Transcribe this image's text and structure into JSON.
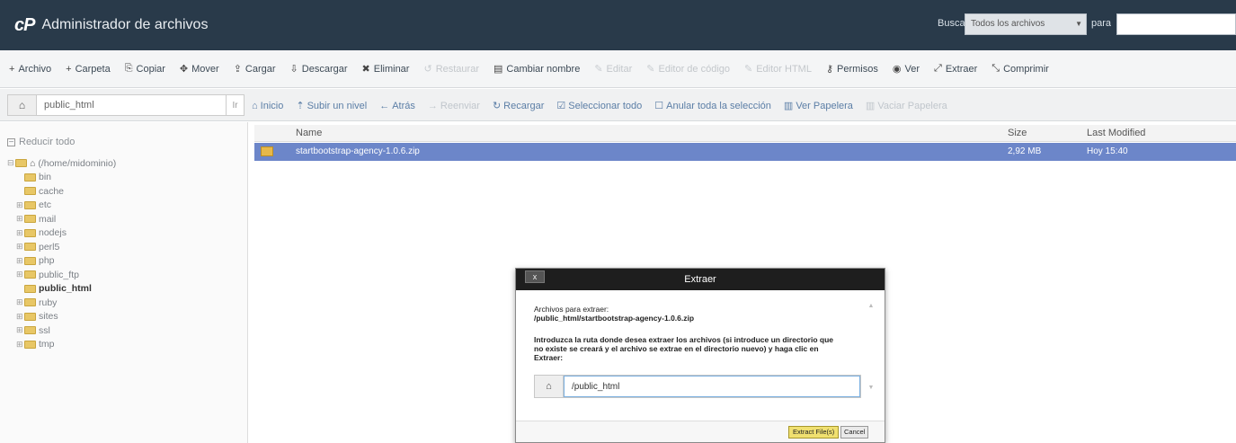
{
  "header": {
    "logo": "cP",
    "title": "Administrador de archivos",
    "search_label": "Buscar",
    "search_scope": "Todos los archivos",
    "search_for_label": "para",
    "search_value": ""
  },
  "toolbar": [
    {
      "icon": "+",
      "label": "Archivo",
      "disabled": false
    },
    {
      "icon": "+",
      "label": "Carpeta",
      "disabled": false
    },
    {
      "icon": "⎘",
      "label": "Copiar",
      "disabled": false
    },
    {
      "icon": "✥",
      "label": "Mover",
      "disabled": false
    },
    {
      "icon": "⇪",
      "label": "Cargar",
      "disabled": false
    },
    {
      "icon": "⇩",
      "label": "Descargar",
      "disabled": false
    },
    {
      "icon": "✖",
      "label": "Eliminar",
      "disabled": false
    },
    {
      "icon": "↺",
      "label": "Restaurar",
      "disabled": true
    },
    {
      "icon": "▤",
      "label": "Cambiar nombre",
      "disabled": false
    },
    {
      "icon": "✎",
      "label": "Editar",
      "disabled": true
    },
    {
      "icon": "✎",
      "label": "Editor de código",
      "disabled": true
    },
    {
      "icon": "✎",
      "label": "Editor HTML",
      "disabled": true
    },
    {
      "icon": "⚷",
      "label": "Permisos",
      "disabled": false
    },
    {
      "icon": "◉",
      "label": "Ver",
      "disabled": false
    },
    {
      "icon": "⤢",
      "label": "Extraer",
      "disabled": false
    },
    {
      "icon": "⤡",
      "label": "Comprimir",
      "disabled": false
    }
  ],
  "nav": {
    "path": "public_html",
    "go": "Ir",
    "buttons": [
      {
        "icon": "⌂",
        "label": "Inicio",
        "disabled": false
      },
      {
        "icon": "⇡",
        "label": "Subir un nivel",
        "disabled": false
      },
      {
        "icon": "←",
        "label": "Atrás",
        "disabled": false
      },
      {
        "icon": "→",
        "label": "Reenviar",
        "disabled": true
      },
      {
        "icon": "↻",
        "label": "Recargar",
        "disabled": false
      },
      {
        "icon": "☑",
        "label": "Seleccionar todo",
        "disabled": false
      },
      {
        "icon": "☐",
        "label": "Anular toda la selección",
        "disabled": false
      },
      {
        "icon": "▥",
        "label": "Ver Papelera",
        "disabled": false
      },
      {
        "icon": "▥",
        "label": "Vaciar Papelera",
        "disabled": true
      }
    ]
  },
  "tree": {
    "collapse_label": "Reducir todo",
    "root": "(/home/midominio)",
    "items": [
      {
        "label": "bin",
        "expandable": false,
        "selected": false
      },
      {
        "label": "cache",
        "expandable": false,
        "selected": false
      },
      {
        "label": "etc",
        "expandable": true,
        "selected": false
      },
      {
        "label": "mail",
        "expandable": true,
        "selected": false
      },
      {
        "label": "nodejs",
        "expandable": true,
        "selected": false
      },
      {
        "label": "perl5",
        "expandable": true,
        "selected": false
      },
      {
        "label": "php",
        "expandable": true,
        "selected": false
      },
      {
        "label": "public_ftp",
        "expandable": true,
        "selected": false
      },
      {
        "label": "public_html",
        "expandable": false,
        "selected": true
      },
      {
        "label": "ruby",
        "expandable": true,
        "selected": false
      },
      {
        "label": "sites",
        "expandable": true,
        "selected": false
      },
      {
        "label": "ssl",
        "expandable": true,
        "selected": false
      },
      {
        "label": "tmp",
        "expandable": true,
        "selected": false
      }
    ]
  },
  "table": {
    "headers": {
      "name": "Name",
      "size": "Size",
      "modified": "Last Modified"
    },
    "rows": [
      {
        "name": "startbootstrap-agency-1.0.6.zip",
        "size": "2,92 MB",
        "modified": "Hoy 15:40"
      }
    ]
  },
  "dialog": {
    "title": "Extraer",
    "close": "x",
    "files_label": "Archivos para extraer:",
    "files_path": "/public_html/startbootstrap-agency-1.0.6.zip",
    "prompt": "Introduzca la ruta donde desea extraer los archivos (si introduce un directorio que no existe se creará y el archivo se extrae en el directorio nuevo) y haga clic en Extraer:",
    "path_value": "/public_html",
    "extract_button": "Extract File(s)",
    "cancel_button": "Cancel"
  }
}
